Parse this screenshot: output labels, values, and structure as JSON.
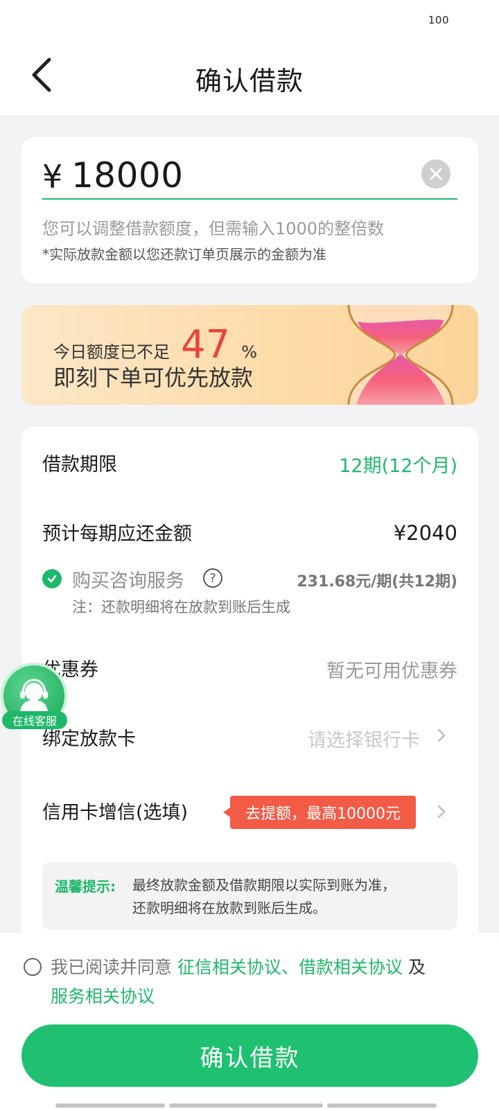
{
  "status_bar": {
    "battery": "100"
  },
  "header": {
    "title": "确认借款"
  },
  "amount": {
    "currency": "¥",
    "value": "18000",
    "hint": "您可以调整借款额度，但需输入1000的整倍数",
    "note": "*实际放款金额以您还款订单页展示的金额为准"
  },
  "promo": {
    "prefix": "今日额度已不足",
    "percent": "47",
    "percent_sign": "%",
    "line2": "即刻下单可优先放款"
  },
  "details": {
    "term_label": "借款期限",
    "term_value": "12期(12个月)",
    "repay_label": "预计每期应还金额",
    "repay_value": "¥2040",
    "consult_label": "购买咨询服务",
    "consult_help": "?",
    "consult_fee": "231.68元/期(共12期)",
    "consult_note": "注：还款明细将在放款到账后生成",
    "coupon_label": "优惠券",
    "coupon_value": "暂无可用优惠券",
    "card_label": "绑定放款卡",
    "card_placeholder": "请选择银行卡",
    "boost_label": "信用卡增信(选填)",
    "boost_tag": "去提额，最高10000元",
    "tip_title": "温馨提示:",
    "tip_line1": "最终放款金额及借款期限以实际到账为准，",
    "tip_line2": "还款明细将在放款到账后生成。"
  },
  "float_service": {
    "label": "在线客服"
  },
  "footer": {
    "agree_prefix": "我已阅读并同意 ",
    "link1": "征信相关协议",
    "sep": "、",
    "link2": "借款相关协议",
    "and": " 及",
    "link3": "服务相关协议",
    "confirm_label": "确认借款"
  },
  "colors": {
    "brand_green": "#1fb86a",
    "alert_red": "#e8453c",
    "tag_red": "#f25b46"
  },
  "icons": [
    "back-arrow-icon",
    "clear-icon",
    "check-circle-icon",
    "question-icon",
    "chevron-right-icon",
    "customer-service-icon",
    "hourglass-illustration"
  ]
}
